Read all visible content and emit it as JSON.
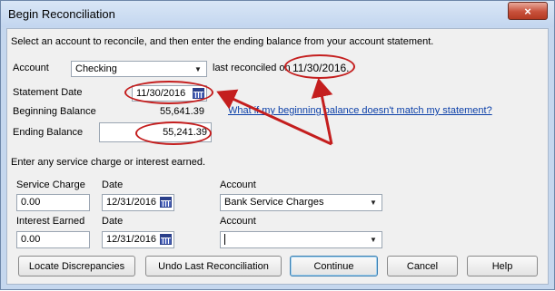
{
  "window": {
    "title": "Begin Reconciliation",
    "close_label": "×"
  },
  "instructions": "Select an account to reconcile, and then enter the ending balance from your account statement.",
  "account": {
    "label": "Account",
    "value": "Checking",
    "last_reconciled_label": "last reconciled on",
    "last_reconciled_date": "11/30/2016."
  },
  "statement_date": {
    "label": "Statement Date",
    "value": "11/30/2016"
  },
  "beginning_balance": {
    "label": "Beginning Balance",
    "value": "55,641.39"
  },
  "ending_balance": {
    "label": "Ending Balance",
    "value": "55,241.39"
  },
  "help_link": "What if my beginning balance doesn't match my statement?",
  "charges_prompt": "Enter any service charge or interest earned.",
  "service_charge": {
    "label": "Service Charge",
    "value": "0.00",
    "date_label": "Date",
    "date": "12/31/2016",
    "account_label": "Account",
    "account": "Bank Service Charges"
  },
  "interest_earned": {
    "label": "Interest Earned",
    "value": "0.00",
    "date_label": "Date",
    "date": "12/31/2016",
    "account_label": "Account",
    "account": ""
  },
  "buttons": {
    "locate": "Locate Discrepancies",
    "undo": "Undo Last Reconciliation",
    "continue": "Continue",
    "cancel": "Cancel",
    "help": "Help"
  },
  "colors": {
    "annotation": "#c41e1e",
    "title_bar": "#c5d7ee",
    "link": "#0b3fa8"
  }
}
